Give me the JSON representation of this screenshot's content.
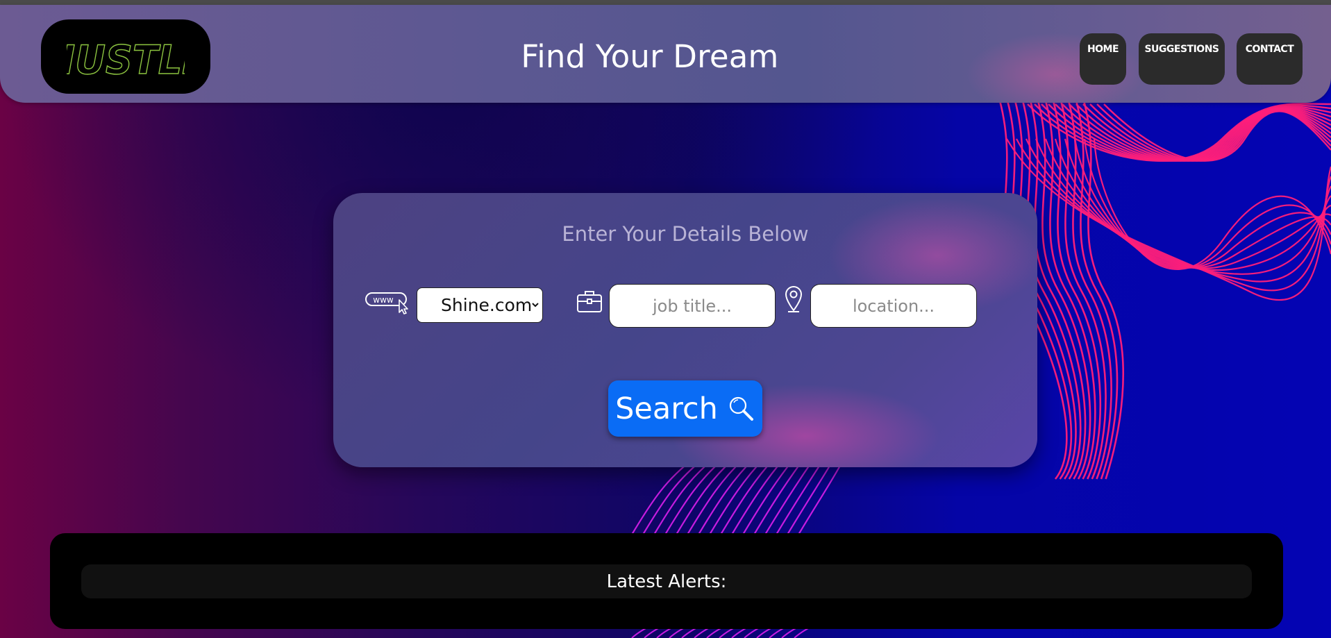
{
  "header": {
    "logo_text": "HUSTLE",
    "title": "Find Your Dream",
    "nav": [
      {
        "label": "HOME"
      },
      {
        "label": "SUGGESTIONS"
      },
      {
        "label": "CONTACT"
      }
    ]
  },
  "search_card": {
    "title": "Enter Your Details Below",
    "site_select": {
      "selected": "Shine.com",
      "icon": "www-cursor-icon"
    },
    "job_title_input": {
      "value": "",
      "placeholder": "job title...",
      "icon": "briefcase-icon"
    },
    "location_input": {
      "value": "",
      "placeholder": "location...",
      "icon": "map-pin-icon"
    },
    "search_button": {
      "label": "Search",
      "icon": "magnifier-icon"
    }
  },
  "alerts": {
    "title": "Latest Alerts:"
  },
  "colors": {
    "search_button": "#0a6cf5",
    "logo_text": "#8bc23f",
    "wave_lines": "#ff1f7a"
  }
}
